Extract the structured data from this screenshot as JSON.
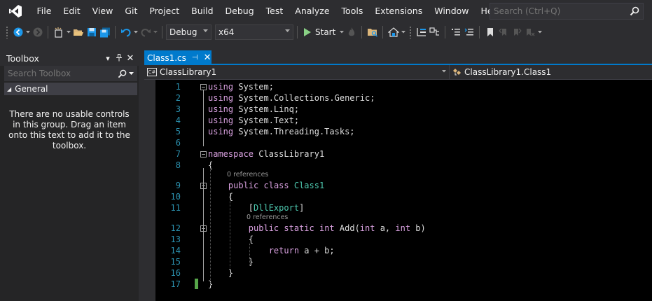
{
  "menu": {
    "items": [
      "File",
      "Edit",
      "View",
      "Git",
      "Project",
      "Build",
      "Debug",
      "Test",
      "Analyze",
      "Tools",
      "Extensions",
      "Window",
      "Help"
    ],
    "search_placeholder": "Search (Ctrl+Q)"
  },
  "toolbar": {
    "configuration": "Debug",
    "platform": "x64",
    "start_label": "Start"
  },
  "toolbox": {
    "title": "Toolbox",
    "search_placeholder": "Search Toolbox",
    "group": "General",
    "empty_message": "There are no usable controls in this group. Drag an item onto this text to add it to the toolbox."
  },
  "editor": {
    "tab_label": "Class1.cs",
    "nav_project": "ClassLibrary1",
    "nav_class": "ClassLibrary1.Class1",
    "codelens": "0 references",
    "lines": [
      {
        "n": "1",
        "parts": [
          [
            "kw-using",
            "using"
          ],
          [
            "",
            " System;"
          ]
        ]
      },
      {
        "n": "2",
        "parts": [
          [
            "kw-using",
            "using"
          ],
          [
            "",
            " System.Collections.Generic;"
          ]
        ]
      },
      {
        "n": "3",
        "parts": [
          [
            "kw-using",
            "using"
          ],
          [
            "",
            " System.Linq;"
          ]
        ]
      },
      {
        "n": "4",
        "parts": [
          [
            "kw-using",
            "using"
          ],
          [
            "",
            " System.Text;"
          ]
        ]
      },
      {
        "n": "5",
        "parts": [
          [
            "kw-using",
            "using"
          ],
          [
            "",
            " System.Threading.Tasks;"
          ]
        ]
      },
      {
        "n": "6",
        "parts": []
      },
      {
        "n": "7",
        "parts": [
          [
            "kw-using",
            "namespace"
          ],
          [
            "",
            " ClassLibrary1"
          ]
        ]
      },
      {
        "n": "8",
        "parts": [
          [
            "",
            "{"
          ]
        ]
      },
      {
        "n": "9",
        "parts": [
          [
            "",
            "    "
          ],
          [
            "kw-using",
            "public"
          ],
          [
            "",
            " "
          ],
          [
            "kw-using",
            "class"
          ],
          [
            "",
            " "
          ],
          [
            "type",
            "Class1"
          ]
        ]
      },
      {
        "n": "10",
        "parts": [
          [
            "",
            "    {"
          ]
        ]
      },
      {
        "n": "11",
        "parts": [
          [
            "",
            "        ["
          ],
          [
            "attr",
            "DllExport"
          ],
          [
            "",
            "]"
          ]
        ]
      },
      {
        "n": "12",
        "parts": [
          [
            "",
            "        "
          ],
          [
            "kw-using",
            "public"
          ],
          [
            "",
            " "
          ],
          [
            "kw-using",
            "static"
          ],
          [
            "",
            " "
          ],
          [
            "kw-using",
            "int"
          ],
          [
            "",
            " Add("
          ],
          [
            "kw-using",
            "int"
          ],
          [
            "",
            " a, "
          ],
          [
            "kw-using",
            "int"
          ],
          [
            "",
            " b)"
          ]
        ]
      },
      {
        "n": "13",
        "parts": [
          [
            "",
            "        {"
          ]
        ]
      },
      {
        "n": "14",
        "parts": [
          [
            "",
            "            "
          ],
          [
            "kw-using",
            "return"
          ],
          [
            "",
            " a + b;"
          ]
        ]
      },
      {
        "n": "15",
        "parts": [
          [
            "",
            "        }"
          ]
        ]
      },
      {
        "n": "16",
        "parts": [
          [
            "",
            "    }"
          ]
        ]
      },
      {
        "n": "17",
        "parts": [
          [
            "",
            "}"
          ]
        ]
      }
    ]
  },
  "colors": {
    "accent": "#007acc",
    "line_number": "#2b91af",
    "keyword": "#d8a0df",
    "type": "#4ec9b0",
    "text": "#dcdcdc"
  }
}
